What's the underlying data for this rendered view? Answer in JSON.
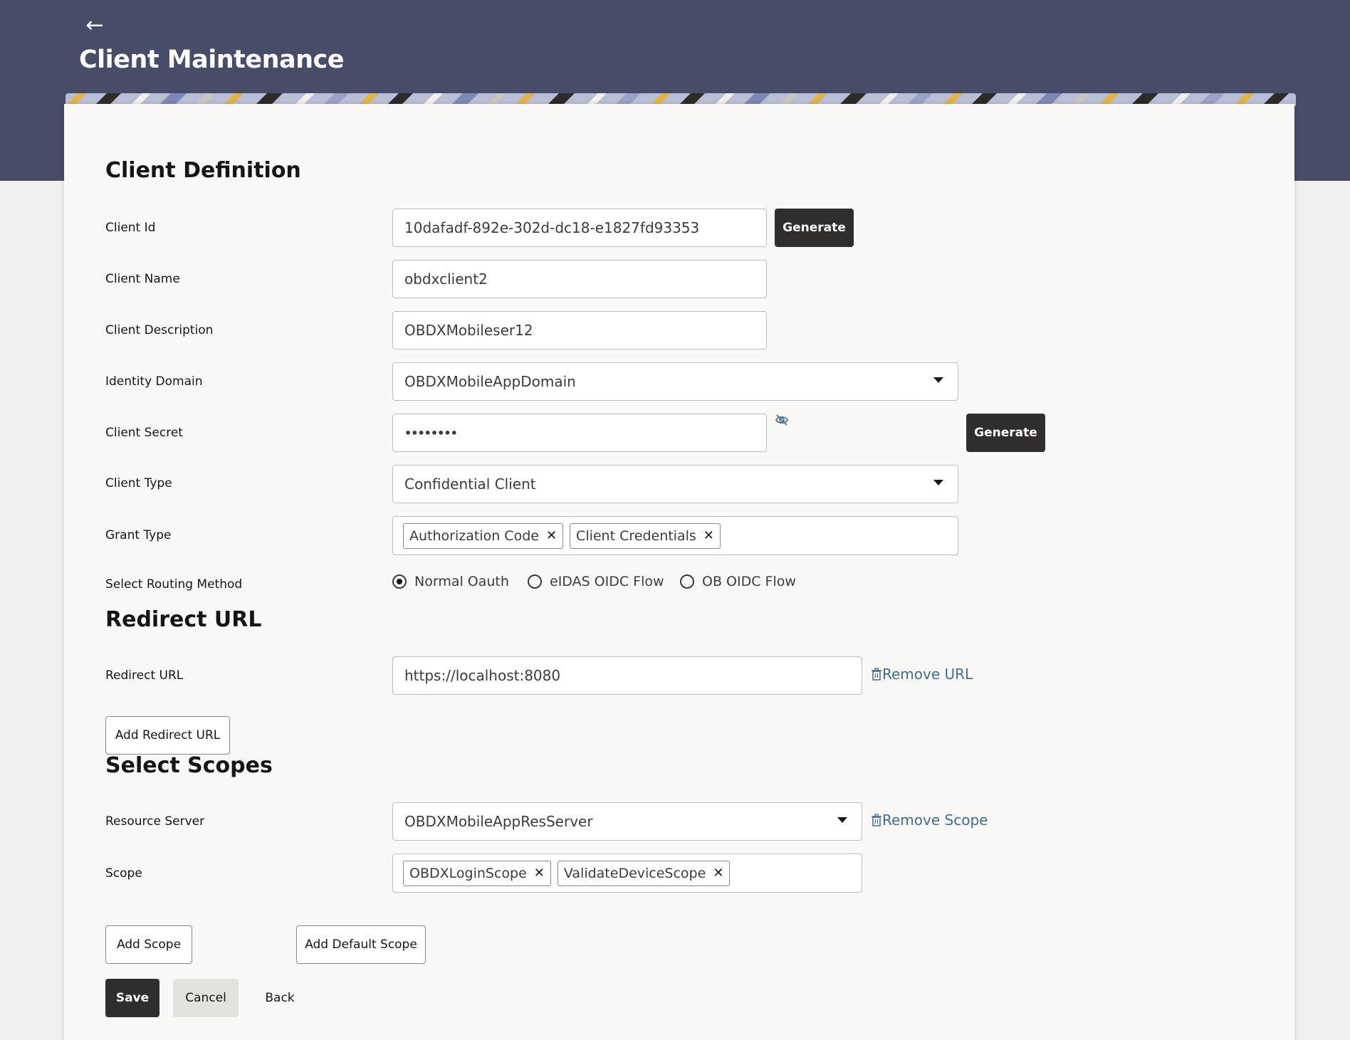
{
  "header": {
    "title": "Client Maintenance",
    "back_icon": "back-arrow-icon"
  },
  "client_definition": {
    "title": "Client Definition",
    "client_id": {
      "label": "Client Id",
      "value": "10dafadf-892e-302d-dc18-e1827fd93353",
      "generate_label": "Generate"
    },
    "client_name": {
      "label": "Client Name",
      "value": "obdxclient2"
    },
    "client_description": {
      "label": "Client Description",
      "value": "OBDXMobileser12"
    },
    "identity_domain": {
      "label": "Identity Domain",
      "value": "OBDXMobileAppDomain"
    },
    "client_secret": {
      "label": "Client Secret",
      "value": "••••••••",
      "generate_label": "Generate",
      "visibility_icon": "eye-slash-icon"
    },
    "client_type": {
      "label": "Client Type",
      "value": "Confidential Client"
    },
    "grant_type": {
      "label": "Grant Type",
      "chips": [
        "Authorization Code",
        "Client Credentials"
      ]
    },
    "routing_method": {
      "label": "Select Routing Method",
      "options": [
        "Normal Oauth",
        "eIDAS OIDC Flow",
        "OB OIDC Flow"
      ],
      "selected": "Normal Oauth"
    }
  },
  "redirect": {
    "title": "Redirect URL",
    "label": "Redirect URL",
    "value": "https://localhost:8080",
    "remove_label": "Remove URL",
    "add_label": "Add Redirect URL"
  },
  "scopes": {
    "title": "Select Scopes",
    "resource_server": {
      "label": "Resource Server",
      "value": "OBDXMobileAppResServer",
      "remove_label": "Remove Scope"
    },
    "scope": {
      "label": "Scope",
      "chips": [
        "OBDXLoginScope",
        "ValidateDeviceScope"
      ]
    },
    "add_scope_label": "Add Scope",
    "add_default_scope_label": "Add Default Scope"
  },
  "actions": {
    "save": "Save",
    "cancel": "Cancel",
    "back": "Back"
  },
  "colors": {
    "header": "#474c68",
    "primary_button": "#312d2a",
    "link": "#3f6e93",
    "card": "#f9f8f6"
  }
}
